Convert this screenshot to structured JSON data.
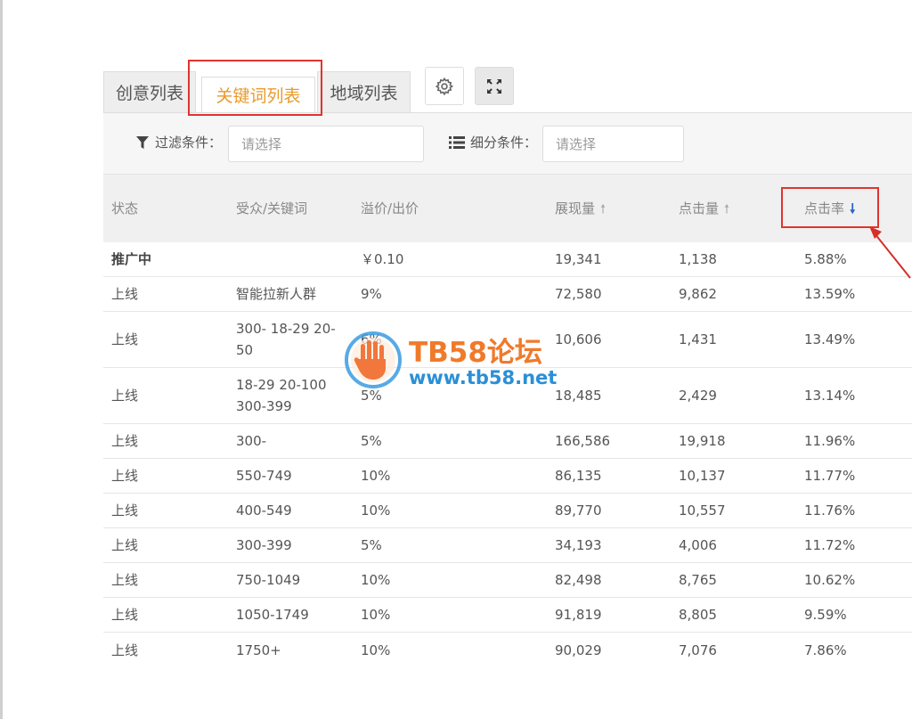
{
  "tabs": [
    {
      "label": "创意列表",
      "active": false
    },
    {
      "label": "关键词列表",
      "active": true
    },
    {
      "label": "地域列表",
      "active": false
    }
  ],
  "toolbar": {
    "settings_icon": "gear-icon",
    "expand_icon": "expand-icon"
  },
  "filters": {
    "filter_label": "过滤条件：",
    "filter_placeholder": "请选择",
    "segment_label": "细分条件：",
    "segment_placeholder": "请选择"
  },
  "table": {
    "columns": {
      "status": "状态",
      "audience": "受众/关键词",
      "bid": "溢价/出价",
      "impressions": "展现量",
      "clicks": "点击量",
      "ctr": "点击率"
    },
    "rows": [
      {
        "status": "推广中",
        "audience": "",
        "bid": "￥0.10",
        "impressions": "19,341",
        "clicks": "1,138",
        "ctr": "5.88%"
      },
      {
        "status": "上线",
        "audience": "智能拉新人群",
        "bid": "9%",
        "impressions": "72,580",
        "clicks": "9,862",
        "ctr": "13.59%"
      },
      {
        "status": "上线",
        "audience": "300- 18-29 20-50",
        "bid": "6%",
        "impressions": "10,606",
        "clicks": "1,431",
        "ctr": "13.49%"
      },
      {
        "status": "上线",
        "audience": "18-29 20-100 300-399",
        "bid": "5%",
        "impressions": "18,485",
        "clicks": "2,429",
        "ctr": "13.14%"
      },
      {
        "status": "上线",
        "audience": "300-",
        "bid": "5%",
        "impressions": "166,586",
        "clicks": "19,918",
        "ctr": "11.96%"
      },
      {
        "status": "上线",
        "audience": "550-749",
        "bid": "10%",
        "impressions": "86,135",
        "clicks": "10,137",
        "ctr": "11.77%"
      },
      {
        "status": "上线",
        "audience": "400-549",
        "bid": "10%",
        "impressions": "89,770",
        "clicks": "10,557",
        "ctr": "11.76%"
      },
      {
        "status": "上线",
        "audience": "300-399",
        "bid": "5%",
        "impressions": "34,193",
        "clicks": "4,006",
        "ctr": "11.72%"
      },
      {
        "status": "上线",
        "audience": "750-1049",
        "bid": "10%",
        "impressions": "82,498",
        "clicks": "8,765",
        "ctr": "10.62%"
      },
      {
        "status": "上线",
        "audience": "1050-1749",
        "bid": "10%",
        "impressions": "91,819",
        "clicks": "8,805",
        "ctr": "9.59%"
      },
      {
        "status": "上线",
        "audience": "1750+",
        "bid": "10%",
        "impressions": "90,029",
        "clicks": "7,076",
        "ctr": "7.86%"
      }
    ]
  },
  "watermark": {
    "title": "TB58论坛",
    "url": "www.tb58.net"
  },
  "colors": {
    "active_tab_text": "#e89a2c",
    "highlight_box": "#e0342f",
    "sort_desc_arrow": "#2a67c4"
  }
}
